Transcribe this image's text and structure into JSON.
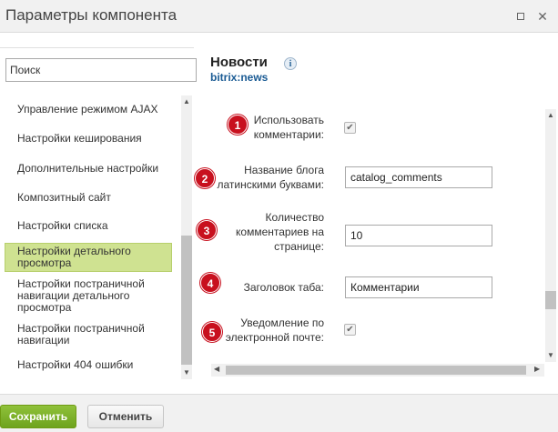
{
  "window": {
    "title": "Параметры компонента",
    "maximize_icon": "maximize-icon",
    "close_icon": "close-icon",
    "close_glyph": "✕"
  },
  "search": {
    "placeholder": "Поиск"
  },
  "sidebar": {
    "items": [
      {
        "label": "Управление режимом AJAX"
      },
      {
        "label": "Настройки кеширования"
      },
      {
        "label": "Дополнительные настройки"
      },
      {
        "label": "Композитный сайт"
      },
      {
        "label": "Настройки списка"
      },
      {
        "label": "Настройки детального просмотра",
        "active": true
      },
      {
        "label": "Настройки постраничной навигации детального просмотра"
      },
      {
        "label": "Настройки постраничной навигации"
      },
      {
        "label": "Настройки 404 ошибки"
      }
    ]
  },
  "component": {
    "title": "Новости",
    "code": "bitrix:news",
    "info_glyph": "i"
  },
  "params": [
    {
      "badge": "1",
      "label": "Использовать комментарии:",
      "type": "checkbox",
      "checked": true
    },
    {
      "badge": "2",
      "label": "Название блога латинскими буквами:",
      "type": "text",
      "value": "catalog_comments"
    },
    {
      "badge": "3",
      "label": "Количество комментариев на странице:",
      "type": "text",
      "value": "10"
    },
    {
      "badge": "4",
      "label": "Заголовок таба:",
      "type": "text",
      "value": "Комментарии"
    },
    {
      "badge": "5",
      "label": "Уведомление по электронной почте:",
      "type": "checkbox",
      "checked": true
    }
  ],
  "checkmark_glyph": "✔",
  "footer": {
    "save_label": "Сохранить",
    "cancel_label": "Отменить"
  },
  "colors": {
    "badge": "#c8101e",
    "active_item": "#cfe291",
    "save_button": "#7cb02a",
    "link": "#1a5b94"
  }
}
